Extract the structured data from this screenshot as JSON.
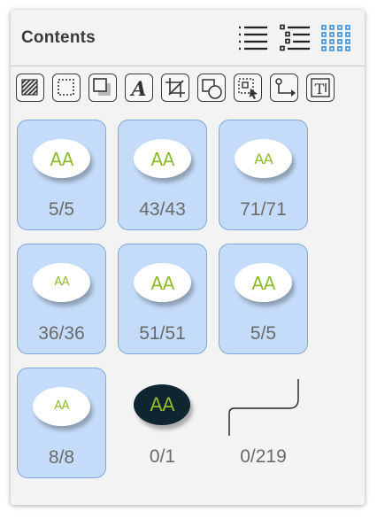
{
  "panel": {
    "title": "Contents"
  },
  "view_modes": [
    {
      "name": "list-view-icon",
      "active": false
    },
    {
      "name": "outline-view-icon",
      "active": false
    },
    {
      "name": "grid-view-icon",
      "active": true
    }
  ],
  "toolbar": [
    {
      "name": "fill-icon"
    },
    {
      "name": "selection-rect-icon"
    },
    {
      "name": "shadow-square-icon"
    },
    {
      "name": "text-style-icon"
    },
    {
      "name": "crop-icon"
    },
    {
      "name": "shapes-icon"
    },
    {
      "name": "group-select-icon"
    },
    {
      "name": "connector-icon"
    },
    {
      "name": "text-box-icon"
    }
  ],
  "items": [
    {
      "count": "5/5",
      "selected": true,
      "glyph": "AA",
      "style": "light"
    },
    {
      "count": "43/43",
      "selected": true,
      "glyph": "AA",
      "style": "light"
    },
    {
      "count": "71/71",
      "selected": true,
      "glyph": "AA",
      "style": "light"
    },
    {
      "count": "36/36",
      "selected": true,
      "glyph": "AA",
      "style": "light"
    },
    {
      "count": "51/51",
      "selected": true,
      "glyph": "AA",
      "style": "light"
    },
    {
      "count": "5/5",
      "selected": true,
      "glyph": "AA",
      "style": "light"
    },
    {
      "count": "8/8",
      "selected": true,
      "glyph": "AA",
      "style": "light"
    },
    {
      "count": "0/1",
      "selected": false,
      "glyph": "AA",
      "style": "dark"
    },
    {
      "count": "0/219",
      "selected": false,
      "glyph": "",
      "style": "line"
    }
  ],
  "colors": {
    "accent": "#3b8fd9",
    "tile_selected": "#c4dcf9",
    "glyph": "#8dbb2a",
    "dark_oval": "#0f2530"
  }
}
